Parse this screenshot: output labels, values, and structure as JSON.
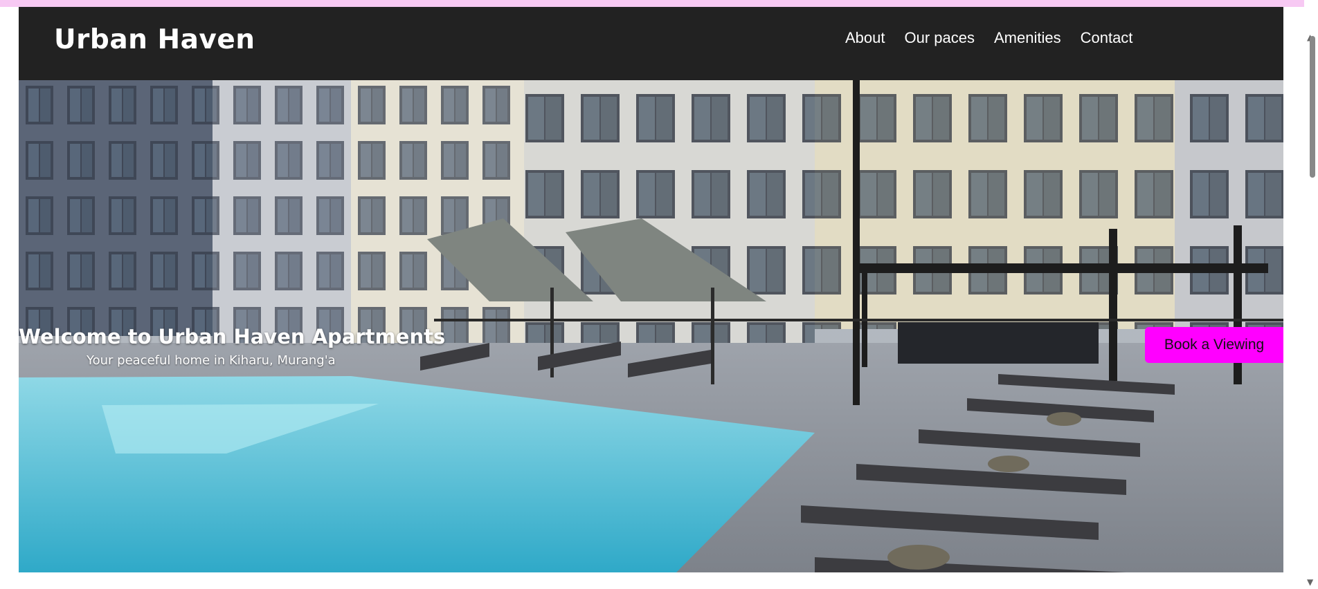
{
  "header": {
    "brand": "Urban Haven",
    "nav": [
      "About",
      "Our paces",
      "Amenities",
      "Contact"
    ]
  },
  "hero": {
    "title": "Welcome to Urban Haven Apartments",
    "subtitle": "Your peaceful home in Kiharu, Murang'a",
    "cta_label": "Book a Viewing"
  },
  "colors": {
    "top_strip": "#f7c9f3",
    "header_bg": "#222222",
    "cta_bg": "#ff00ff",
    "pool_water": "#5fc3da"
  },
  "icons": {
    "scroll_up": "scroll-up-arrow-icon",
    "scroll_down": "scroll-down-arrow-icon"
  }
}
